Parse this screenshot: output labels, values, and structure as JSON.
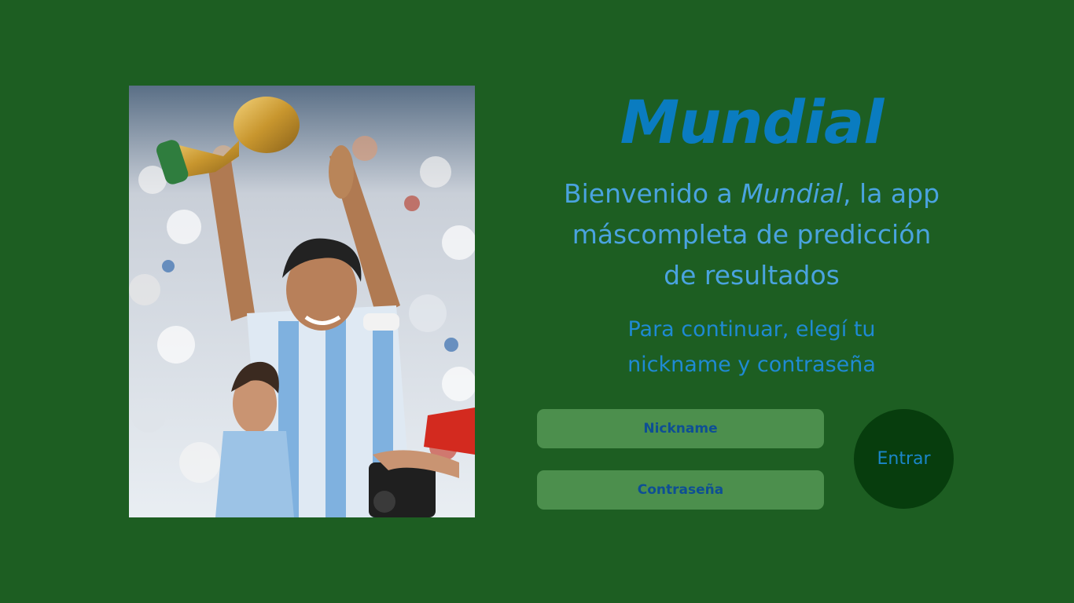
{
  "app": {
    "title": "Mundial"
  },
  "hero_image": {
    "alt": "hero-photo"
  },
  "welcome": {
    "prefix": "Bienvenido a ",
    "brand": "Mundial",
    "suffix_line1": ", la app",
    "line2": "máscompleta de predicción",
    "line3": "de resultados"
  },
  "instructions": {
    "line1": "Para continuar, elegí tu",
    "line2": "nickname y contraseña"
  },
  "form": {
    "nickname_placeholder": "Nickname",
    "password_placeholder": "Contraseña",
    "submit_label": "Entrar"
  },
  "colors": {
    "background": "#1d5e22",
    "title": "#0a7cc0",
    "welcome_text": "#4aa3df",
    "instructions_text": "#1f8ad3",
    "field_bg": "#4c8f4d",
    "field_text": "#0e4f94",
    "button_bg": "#073d0d",
    "button_text": "#1a86c9"
  }
}
